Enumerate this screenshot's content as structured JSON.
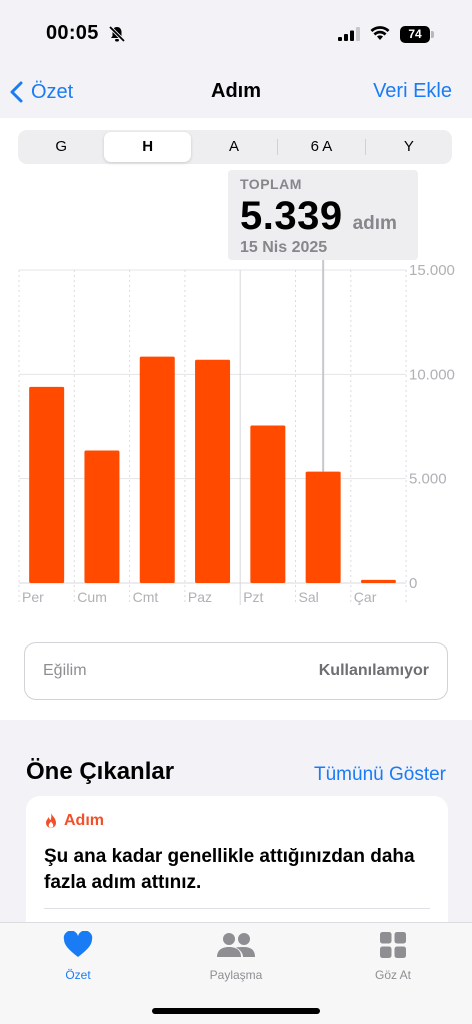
{
  "status": {
    "time": "00:05",
    "battery": "74"
  },
  "nav": {
    "back_label": "Özet",
    "title": "Adım",
    "action_label": "Veri Ekle"
  },
  "segments": [
    "G",
    "H",
    "A",
    "6 A",
    "Y"
  ],
  "active_segment": "H",
  "tooltip": {
    "label": "TOPLAM",
    "value": "5.339",
    "unit": "adım",
    "date": "15 Nis 2025"
  },
  "chart_data": {
    "type": "bar",
    "categories": [
      "Per",
      "Cum",
      "Cmt",
      "Paz",
      "Pzt",
      "Sal",
      "Çar"
    ],
    "values": [
      9400,
      6350,
      10850,
      10700,
      7550,
      5339,
      150
    ],
    "y_ticks": [
      "15.000",
      "10.000",
      "5.000",
      "0"
    ],
    "ylim": [
      0,
      15000
    ],
    "selected_category": "Sal",
    "bar_color": "#ff4a00"
  },
  "trend": {
    "label": "Eğilim",
    "value": "Kullanılamıyor"
  },
  "highlights": {
    "title": "Öne Çıkanlar",
    "show_all": "Tümünü Göster",
    "card": {
      "category": "Adım",
      "text": "Şu ana kadar genellikle attığınızdan daha fazla adım attınız."
    }
  },
  "tabs": [
    {
      "label": "Özet",
      "icon": "heart-icon",
      "active": true
    },
    {
      "label": "Paylaşma",
      "icon": "people-icon",
      "active": false
    },
    {
      "label": "Göz At",
      "icon": "grid-icon",
      "active": false
    }
  ],
  "colors": {
    "accent": "#1a7cf5",
    "bars": "#ff4a00",
    "highlight_orange": "#f0502a"
  }
}
